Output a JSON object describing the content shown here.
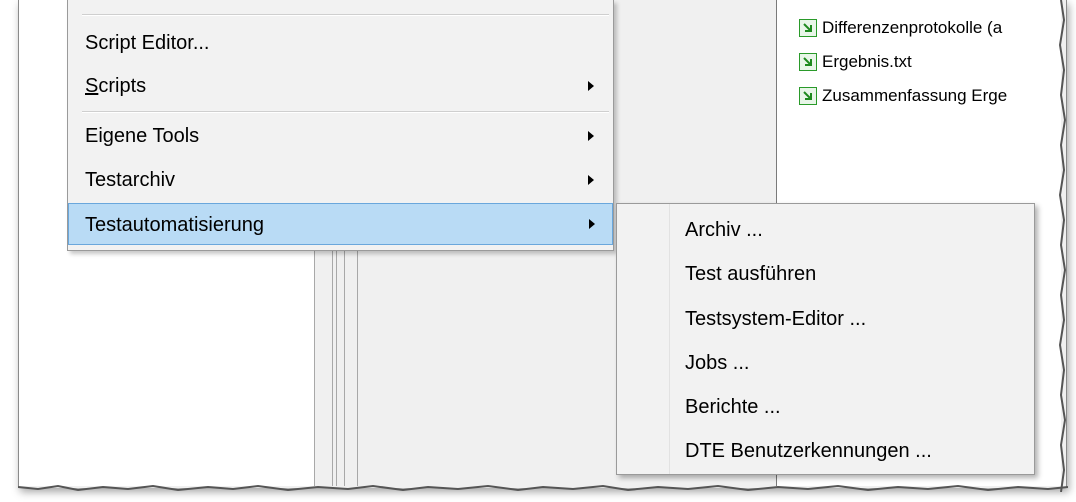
{
  "main_menu": {
    "items": [
      {
        "label": "Script Editor...",
        "has_submenu": false
      },
      {
        "label_pre": "",
        "label_accel": "S",
        "label_post": "cripts",
        "has_submenu": true
      },
      {
        "label": "Eigene Tools",
        "has_submenu": true
      },
      {
        "label": "Testarchiv",
        "has_submenu": true
      },
      {
        "label": "Testautomatisierung",
        "has_submenu": true,
        "highlighted": true
      }
    ]
  },
  "sub_menu": {
    "items": [
      {
        "label": "Archiv ..."
      },
      {
        "label": "Test ausführen"
      },
      {
        "label": "Testsystem-Editor ..."
      },
      {
        "label": "Jobs ..."
      },
      {
        "label": "Berichte ..."
      },
      {
        "label": "DTE Benutzerkennungen ..."
      }
    ]
  },
  "file_list": {
    "items": [
      {
        "name": "Differenzenprotokolle (a",
        "icon": "arrow-document-icon"
      },
      {
        "name": "Ergebnis.txt",
        "icon": "arrow-document-icon"
      },
      {
        "name": "Zusammenfassung Erge",
        "icon": "arrow-document-icon"
      }
    ]
  },
  "colors": {
    "highlight_bg": "#b9dbf5",
    "highlight_border": "#6aa7dc",
    "icon_green": "#2a9a2a"
  }
}
